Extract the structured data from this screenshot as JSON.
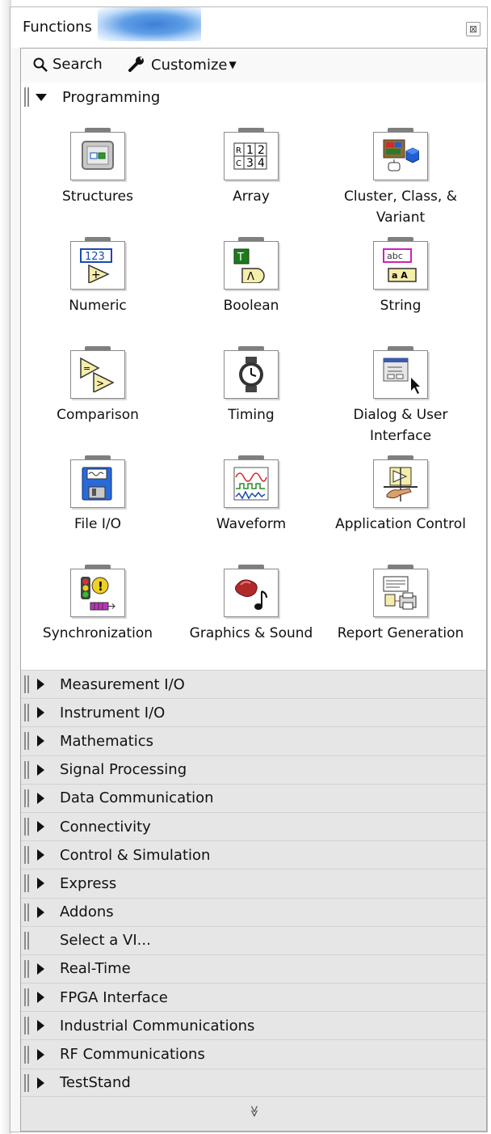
{
  "window": {
    "title": "Functions",
    "close_glyph": "⊠"
  },
  "toolbar": {
    "search_label": "Search",
    "customize_label": "Customize"
  },
  "programming": {
    "label": "Programming",
    "items": [
      {
        "label": "Structures",
        "icon": "structures-icon"
      },
      {
        "label": "Array",
        "icon": "array-icon"
      },
      {
        "label": "Cluster, Class, & Variant",
        "icon": "cluster-class-variant-icon"
      },
      {
        "label": "Numeric",
        "icon": "numeric-icon"
      },
      {
        "label": "Boolean",
        "icon": "boolean-icon"
      },
      {
        "label": "String",
        "icon": "string-icon"
      },
      {
        "label": "Comparison",
        "icon": "comparison-icon"
      },
      {
        "label": "Timing",
        "icon": "timing-icon"
      },
      {
        "label": "Dialog & User Interface",
        "icon": "dialog-user-interface-icon"
      },
      {
        "label": "File I/O",
        "icon": "file-io-icon"
      },
      {
        "label": "Waveform",
        "icon": "waveform-icon"
      },
      {
        "label": "Application Control",
        "icon": "application-control-icon"
      },
      {
        "label": "Synchronization",
        "icon": "synchronization-icon"
      },
      {
        "label": "Graphics & Sound",
        "icon": "graphics-sound-icon"
      },
      {
        "label": "Report Generation",
        "icon": "report-generation-icon"
      }
    ]
  },
  "categories": [
    "Measurement I/O",
    "Instrument I/O",
    "Mathematics",
    "Signal Processing",
    "Data Communication",
    "Connectivity",
    "Control & Simulation",
    "Express",
    "Addons",
    "Select a VI...",
    "Real-Time",
    "FPGA Interface",
    "Industrial Communications",
    "RF Communications",
    "TestStand"
  ],
  "footer": {
    "more_glyph": "≫"
  }
}
